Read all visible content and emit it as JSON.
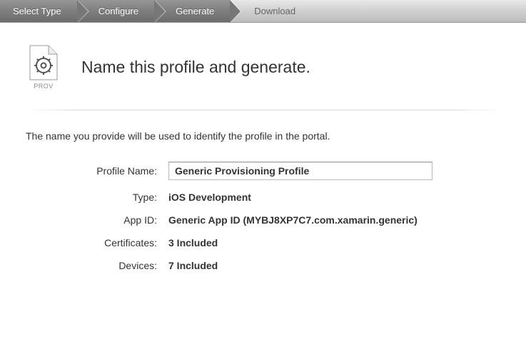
{
  "breadcrumb": {
    "steps": [
      {
        "label": "Select Type",
        "state": "done"
      },
      {
        "label": "Configure",
        "state": "done"
      },
      {
        "label": "Generate",
        "state": "done"
      },
      {
        "label": "Download",
        "state": "inactive"
      }
    ]
  },
  "icon": {
    "caption": "PROV"
  },
  "title": "Name this profile and generate.",
  "description": "The name you provide will be used to identify the profile in the portal.",
  "form": {
    "profileName": {
      "label": "Profile Name:",
      "value": "Generic Provisioning Profile"
    },
    "type": {
      "label": "Type:",
      "value": "iOS Development"
    },
    "appId": {
      "label": "App ID:",
      "value": "Generic App ID (MYBJ8XP7C7.com.xamarin.generic)"
    },
    "certificates": {
      "label": "Certificates:",
      "value": "3 Included"
    },
    "devices": {
      "label": "Devices:",
      "value": "7 Included"
    }
  }
}
